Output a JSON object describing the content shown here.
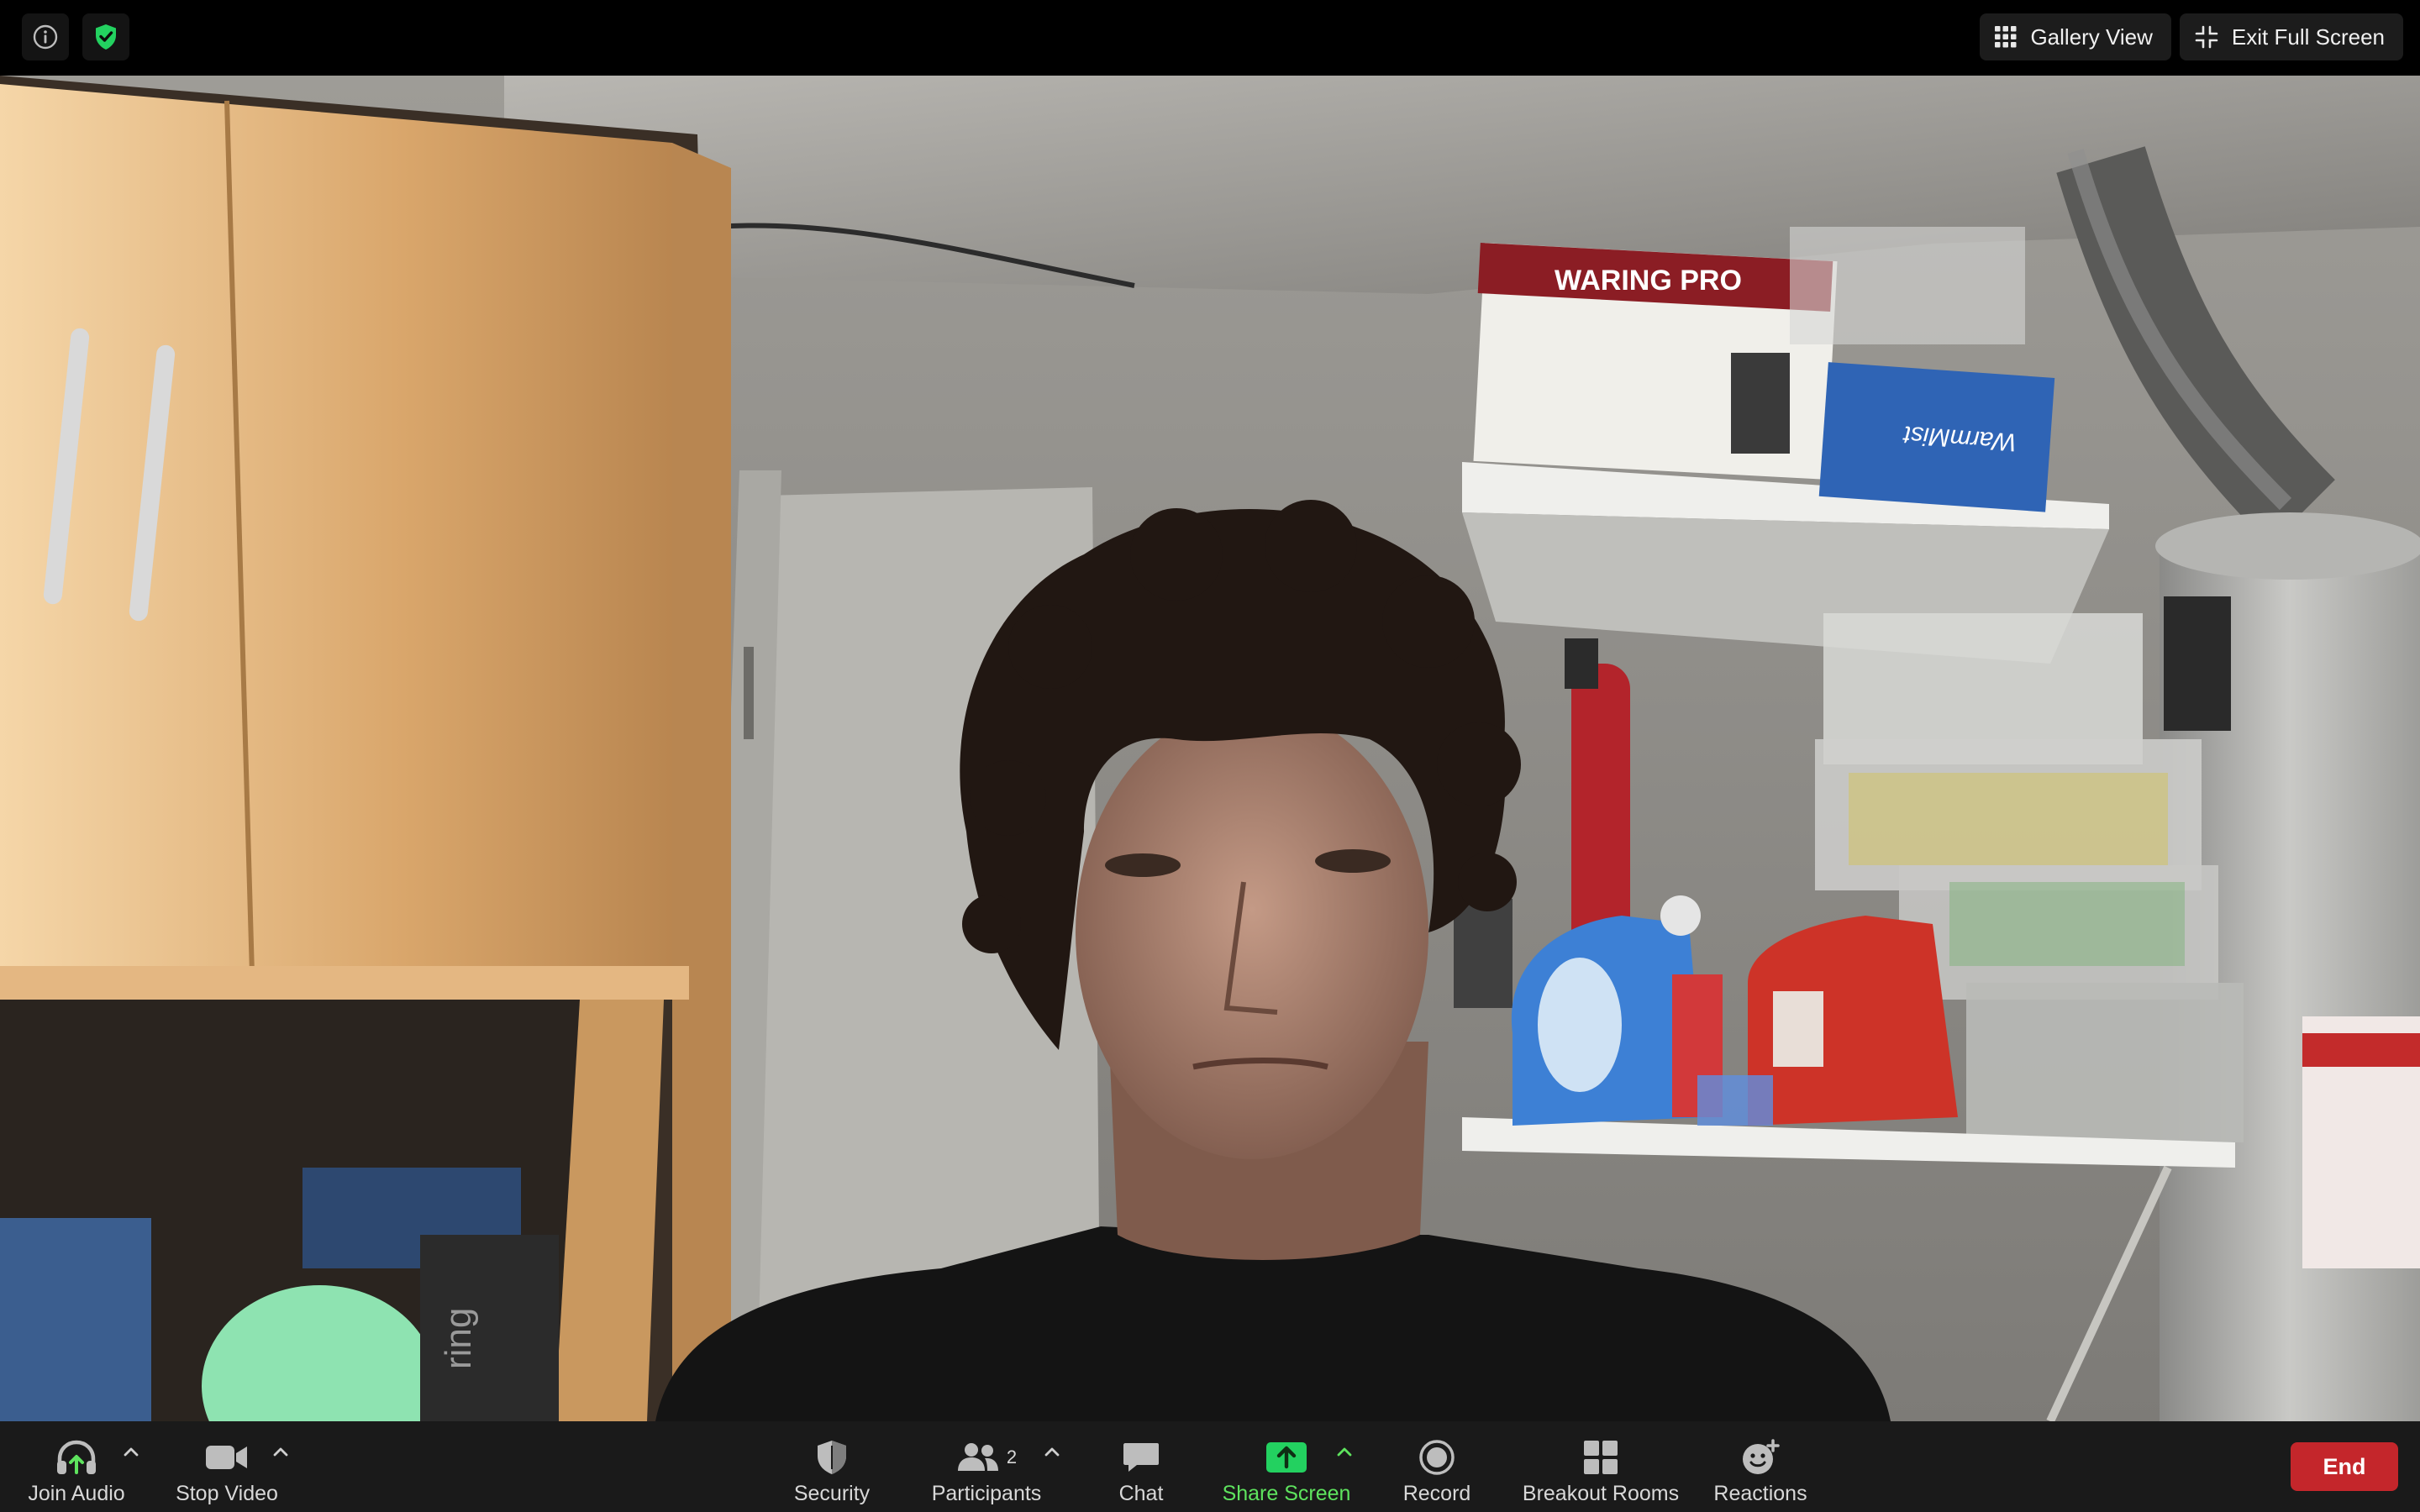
{
  "top_bar": {
    "gallery_view_label": "Gallery View",
    "exit_full_screen_label": "Exit Full Screen"
  },
  "icons": {
    "info": "info-icon",
    "encryption": "shield-check-icon",
    "gallery": "grid-icon",
    "exit_full_screen": "compress-icon"
  },
  "toolbar": {
    "join_audio_label": "Join Audio",
    "stop_video_label": "Stop Video",
    "security_label": "Security",
    "participants_label": "Participants",
    "participants_count": "2",
    "chat_label": "Chat",
    "share_screen_label": "Share Screen",
    "record_label": "Record",
    "breakout_rooms_label": "Breakout Rooms",
    "reactions_label": "Reactions",
    "end_label": "End"
  },
  "video": {
    "box_brand_text": "WARING PRO",
    "box_side_text": "WarmMist",
    "tower_text": "ring"
  },
  "colors": {
    "accent_green": "#5ee35e",
    "end_red": "#c4262b",
    "toolbar_bg": "#1a1a1a",
    "topbar_bg": "#000000"
  }
}
